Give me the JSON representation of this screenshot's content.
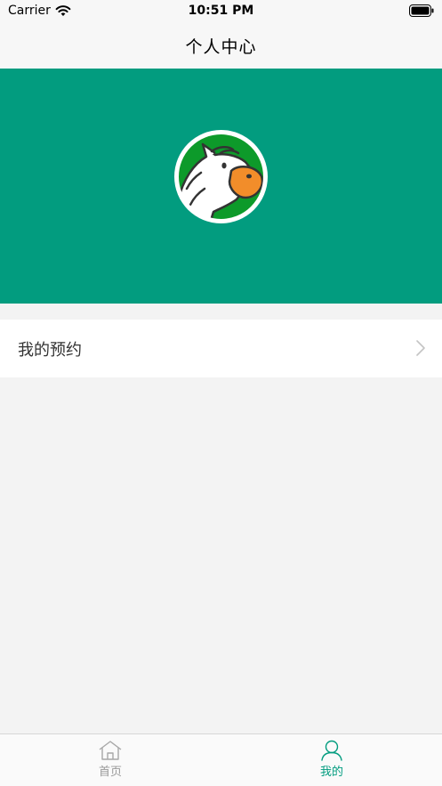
{
  "status_bar": {
    "carrier": "Carrier",
    "time": "10:51 PM",
    "icons": [
      "wifi-icon",
      "battery-icon"
    ]
  },
  "nav": {
    "title": "个人中心"
  },
  "profile": {
    "banner_color": "#029c7f",
    "avatar_icon": "zebra-mascot-icon"
  },
  "menu": {
    "items": [
      {
        "label": "我的预约",
        "icon": "chevron-right-icon"
      }
    ]
  },
  "tab_bar": {
    "accent_color": "#029c7f",
    "items": [
      {
        "label": "首页",
        "icon": "home-icon",
        "selected": false
      },
      {
        "label": "我的",
        "icon": "user-icon",
        "selected": true
      }
    ]
  }
}
